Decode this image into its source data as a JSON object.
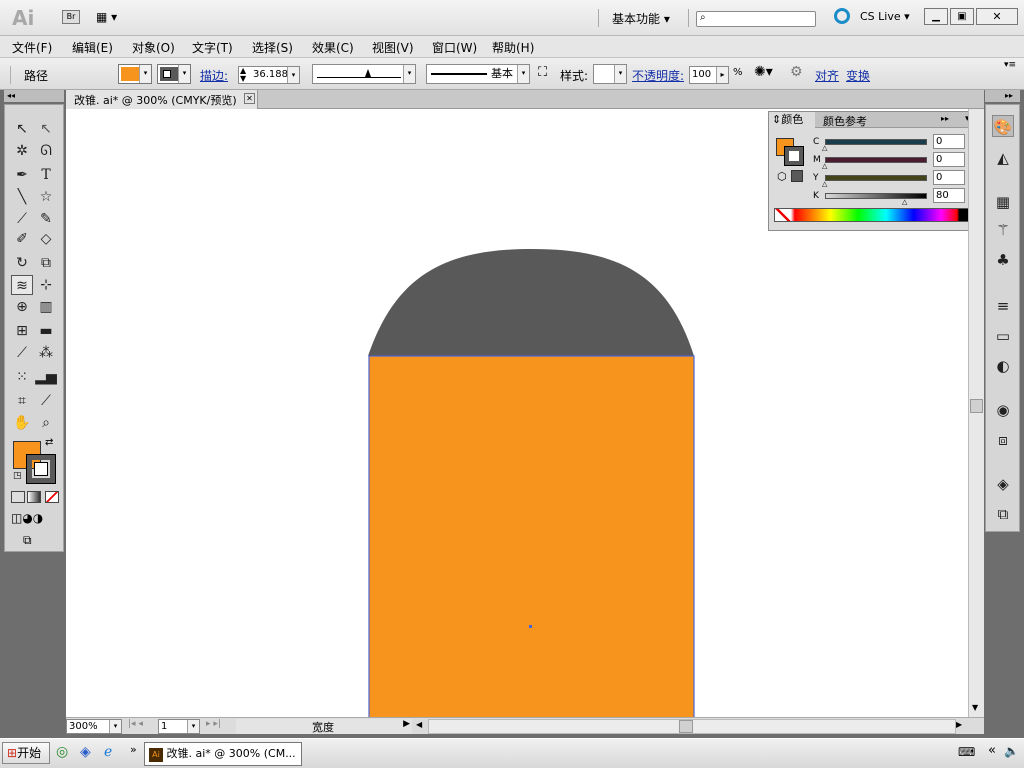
{
  "app": {
    "logo": "Ai",
    "bridge": "Br",
    "workspace": "基本功能",
    "search_placeholder": "",
    "cslive": "CS Live"
  },
  "menu": [
    "文件(F)",
    "编辑(E)",
    "对象(O)",
    "文字(T)",
    "选择(S)",
    "效果(C)",
    "视图(V)",
    "窗口(W)",
    "帮助(H)"
  ],
  "control": {
    "selection_type": "路径",
    "stroke_label": "描边:",
    "stroke_weight": "36.188",
    "profile_label": "基本",
    "style_label": "样式:",
    "opacity_label": "不透明度:",
    "opacity_value": "100",
    "percent": "%",
    "align_label": "对齐",
    "transform_label": "变换"
  },
  "document": {
    "tab_title": "改锥. ai* @ 300% (CMYK/预览)"
  },
  "color_panel": {
    "tab_color": "颜色",
    "tab_guide": "颜色参考",
    "channels": [
      {
        "label": "C",
        "value": "0"
      },
      {
        "label": "M",
        "value": "0"
      },
      {
        "label": "Y",
        "value": "0"
      },
      {
        "label": "K",
        "value": "80"
      }
    ],
    "percent": "%"
  },
  "status": {
    "zoom": "300%",
    "page": "1",
    "info": "宽度"
  },
  "taskbar": {
    "start": "开始",
    "task": "改锥. ai* @ 300% (CM..."
  },
  "colors": {
    "orange": "#f7941e",
    "dark_gray": "#595959",
    "selection_blue": "#4a64d8"
  }
}
